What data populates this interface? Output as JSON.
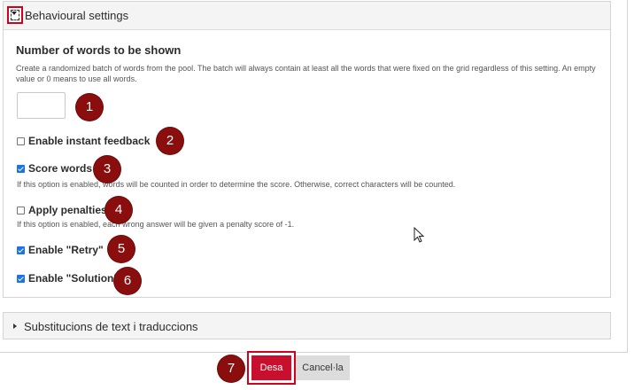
{
  "behavioural_panel": {
    "title": "Behavioural settings"
  },
  "number_of_words": {
    "label": "Number of words to be shown",
    "description": "Create a randomized batch of words from the pool. The batch will always contain at least all the words that were fixed on the grid regardless of this setting. An empty value or 0 means to use all words.",
    "value": ""
  },
  "options": [
    {
      "label": "Enable instant feedback",
      "checked": false
    },
    {
      "label": "Score words",
      "checked": true,
      "description": "If this option is enabled, words will be counted in order to determine the score. Otherwise, correct characters will be counted."
    },
    {
      "label": "Apply penalties",
      "checked": false,
      "description": "If this option is enabled, each wrong answer will be given a penalty score of -1."
    },
    {
      "label": "Enable \"Retry\"",
      "checked": true
    },
    {
      "label": "Enable \"Solution\"",
      "checked": true
    }
  ],
  "markers": [
    "1",
    "2",
    "3",
    "4",
    "5",
    "6",
    "7"
  ],
  "substitutions_panel": {
    "title": "Substitucions de text i traduccions"
  },
  "actions": {
    "save_label": "Desa",
    "cancel_label": "Cancel·la"
  },
  "colors": {
    "marker": "#8b0e0e",
    "highlight_border": "#d0021b",
    "save_button": "#c8102e",
    "checkbox_checked": "#1a73e8"
  }
}
